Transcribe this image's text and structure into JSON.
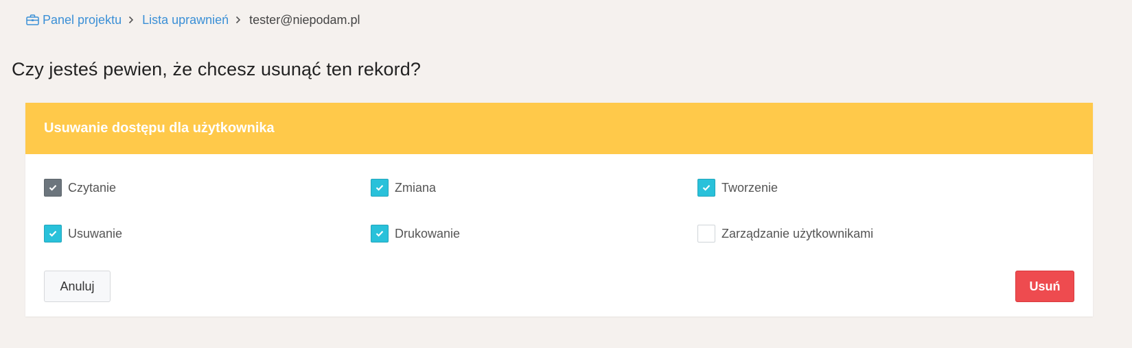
{
  "breadcrumb": {
    "items": [
      {
        "label": "Panel projektu",
        "icon": "briefcase-icon"
      },
      {
        "label": "Lista uprawnień"
      }
    ],
    "current": "tester@niepodam.pl"
  },
  "page_title": "Czy jesteś pewien, że chcesz usunąć ten rekord?",
  "card": {
    "header_title": "Usuwanie dostępu dla użytkownika",
    "permissions": [
      {
        "label": "Czytanie",
        "checked": true,
        "style": "grey"
      },
      {
        "label": "Zmiana",
        "checked": true,
        "style": "cyan"
      },
      {
        "label": "Tworzenie",
        "checked": true,
        "style": "cyan"
      },
      {
        "label": "Usuwanie",
        "checked": true,
        "style": "cyan"
      },
      {
        "label": "Drukowanie",
        "checked": true,
        "style": "cyan"
      },
      {
        "label": "Zarządzanie użytkownikami",
        "checked": false,
        "style": "empty"
      }
    ],
    "cancel_label": "Anuluj",
    "delete_label": "Usuń"
  },
  "colors": {
    "link": "#3a8fd6",
    "header": "#ffc94a",
    "check_cyan": "#29c1da",
    "check_grey": "#6c757d",
    "danger": "#ee4b4f"
  }
}
